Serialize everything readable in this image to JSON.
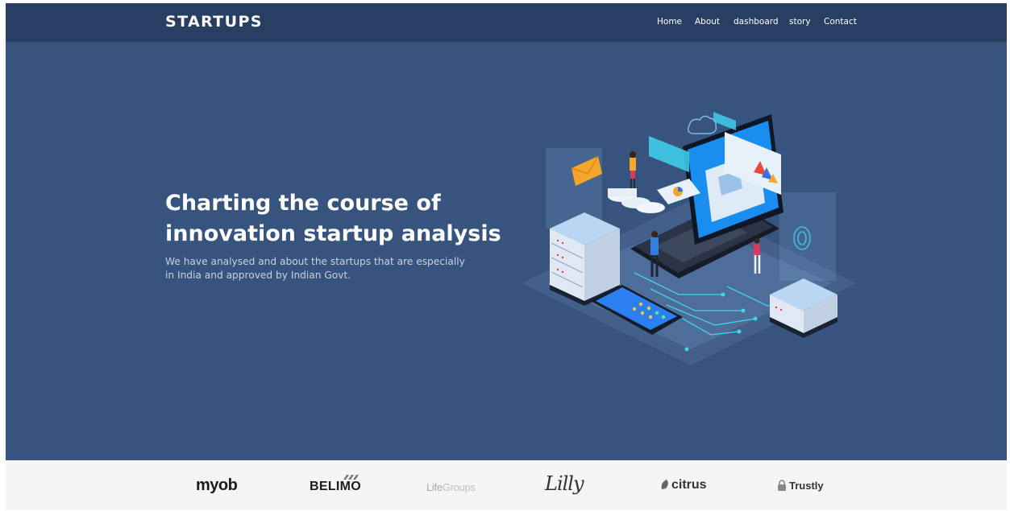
{
  "brand": {
    "name": "STARTUPS"
  },
  "nav": {
    "items": [
      {
        "label": "Home"
      },
      {
        "label": "About"
      },
      {
        "label": "dashboard"
      },
      {
        "label": "story"
      },
      {
        "label": "Contact"
      }
    ]
  },
  "hero": {
    "headline_line1": "Charting the course of",
    "headline_line2": "innovation startup analysis",
    "subtext_line1": "We have analysed and about the startups that are especially",
    "subtext_line2": "in India and approved by Indian Govt.",
    "illustration_icon": "isometric-laptop-data-analytics-illustration"
  },
  "logos": {
    "items": [
      {
        "name": "myob"
      },
      {
        "name": "BELIMO"
      },
      {
        "name": "Life",
        "suffix": "Groups"
      },
      {
        "name": "Lilly"
      },
      {
        "name": "citrus"
      },
      {
        "name": "Trustly"
      }
    ]
  },
  "colors": {
    "navbar": "#283e63",
    "hero_background": "#37547f",
    "logo_strip": "#f5f5f8",
    "accent_cyan": "#3fd4f0"
  }
}
